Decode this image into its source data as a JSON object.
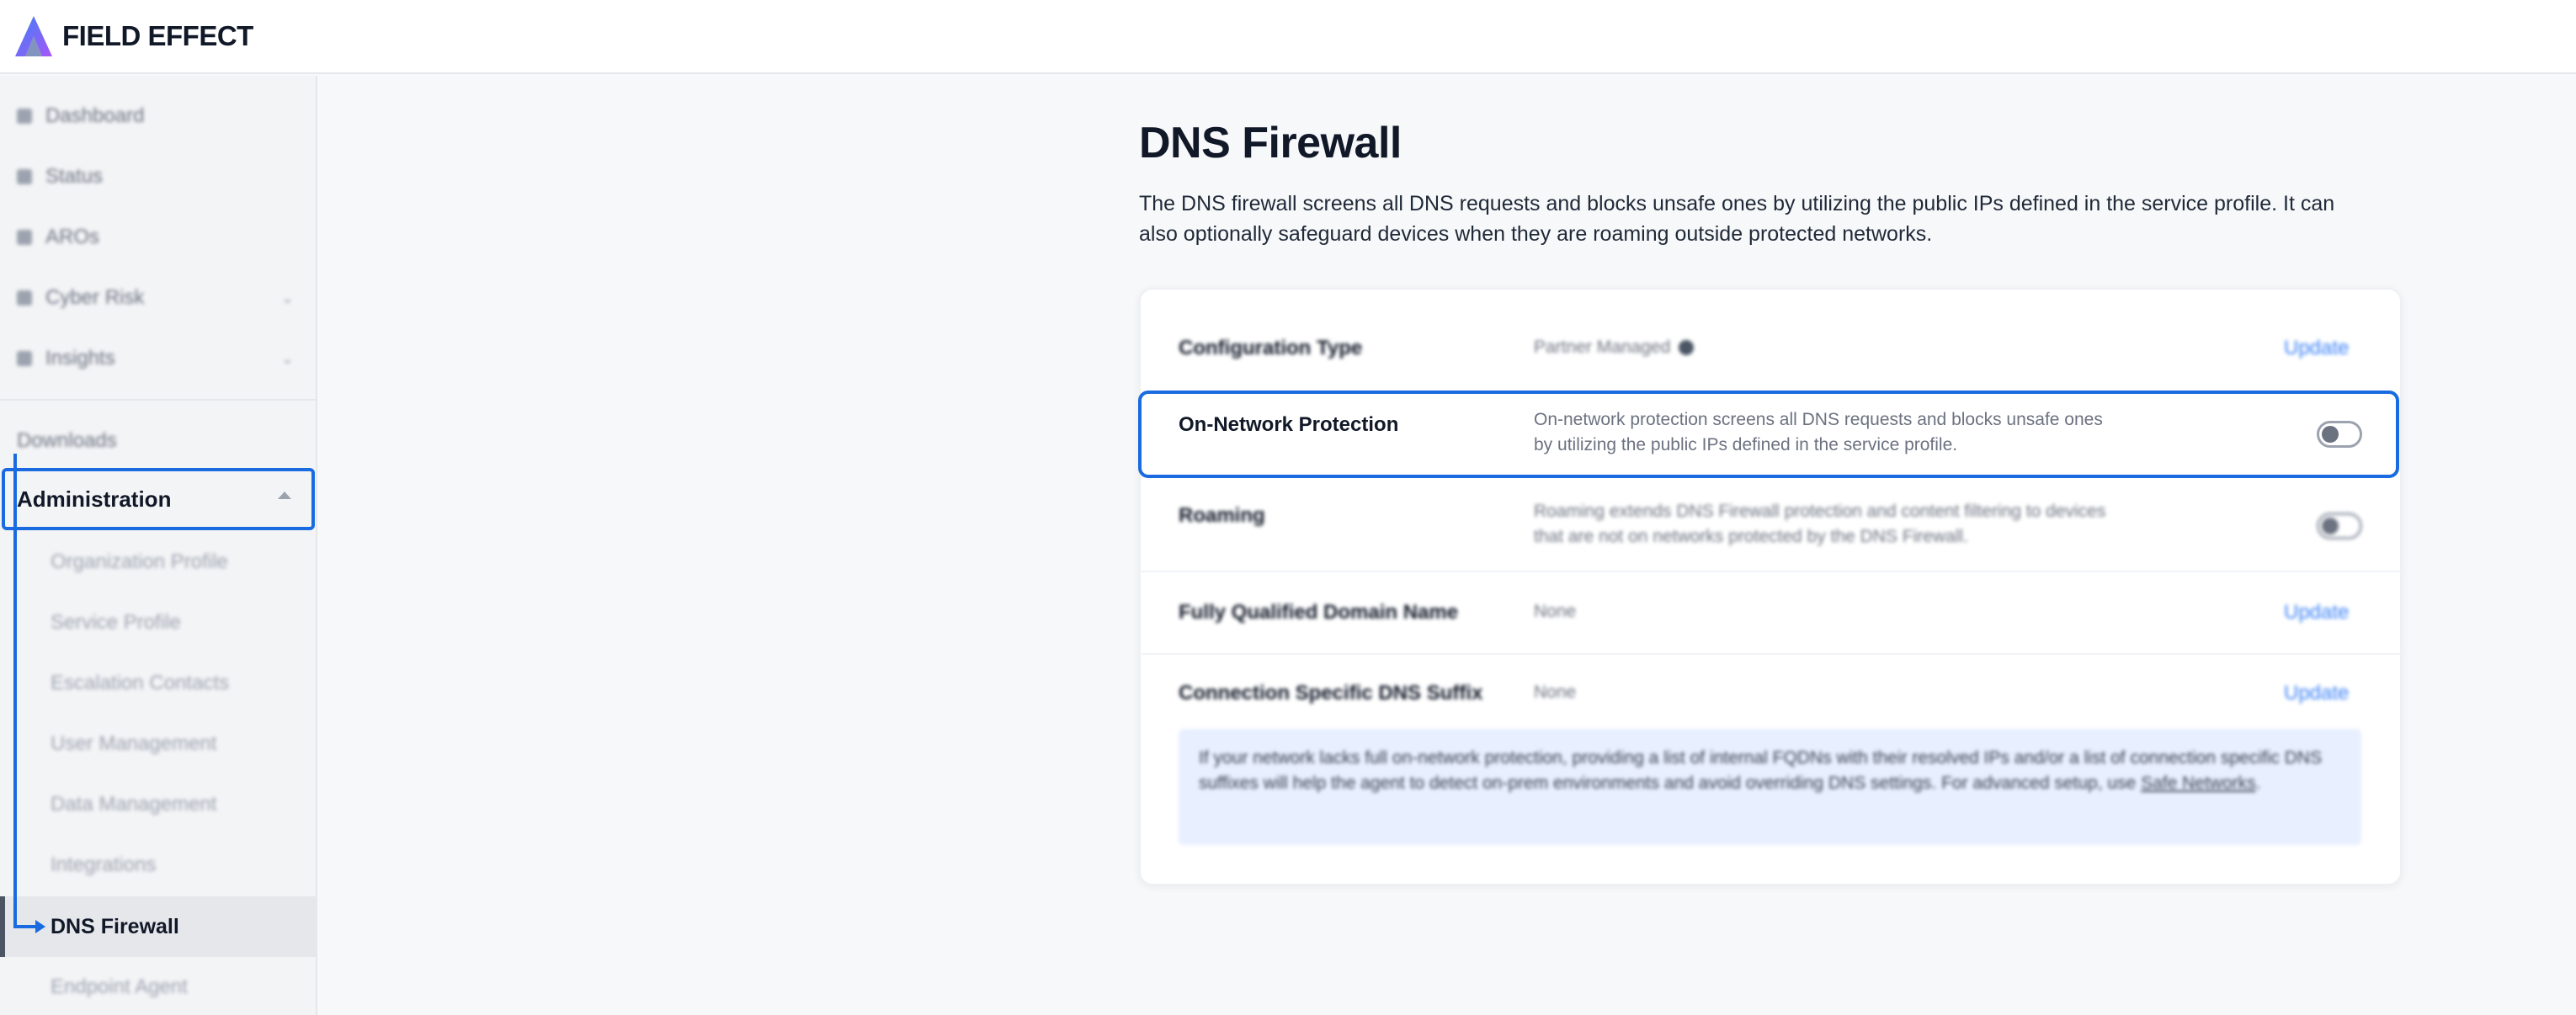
{
  "brand": {
    "name": "FIELD EFFECT",
    "colors": {
      "accent": "#1a6be0",
      "link": "#3b82f6",
      "logo_top": "#3b82f6",
      "logo_bottom": "#a855f7"
    }
  },
  "sidebar": {
    "items": [
      {
        "label": "Dashboard",
        "icon": "dashboard-icon"
      },
      {
        "label": "Status",
        "icon": "status-icon"
      },
      {
        "label": "AROs",
        "icon": "aro-icon"
      },
      {
        "label": "Cyber Risk",
        "icon": "cyber-risk-icon",
        "expandable": true
      },
      {
        "label": "Insights",
        "icon": "insights-icon",
        "expandable": true
      }
    ],
    "downloads_label": "Downloads",
    "administration": {
      "label": "Administration",
      "expanded": true,
      "children": [
        "Organization Profile",
        "Service Profile",
        "Escalation Contacts",
        "User Management",
        "Data Management",
        "Integrations"
      ],
      "active": "DNS Firewall",
      "after_active": "Endpoint Agent"
    }
  },
  "main": {
    "title": "DNS Firewall",
    "description": "The DNS firewall screens all DNS requests and blocks unsafe ones by utilizing the public IPs defined in the service profile. It can also optionally safeguard devices when they are roaming outside protected networks.",
    "settings": {
      "config_type": {
        "label": "Configuration Type",
        "value": "Partner Managed",
        "action": "Update"
      },
      "on_network": {
        "label": "On-Network Protection",
        "value": "On-network protection screens all DNS requests and blocks unsafe ones by utilizing the public IPs defined in the service profile.",
        "enabled": false
      },
      "roaming": {
        "label": "Roaming",
        "value": "Roaming extends DNS Firewall protection and content filtering to devices that are not on networks protected by the DNS Firewall.",
        "enabled": false
      },
      "fqdn": {
        "label": "Fully Qualified Domain Name",
        "value": "None",
        "action": "Update"
      },
      "dns_suffix": {
        "label": "Connection Specific DNS Suffix",
        "value": "None",
        "action": "Update"
      }
    },
    "info": {
      "text": "If your network lacks full on-network protection, providing a list of internal FQDNs with their resolved IPs and/or a list of connection specific DNS suffixes will help the agent to detect on-prem environments and avoid overriding DNS settings. For advanced setup, use ",
      "link": "Safe Networks",
      "tail": "."
    }
  }
}
